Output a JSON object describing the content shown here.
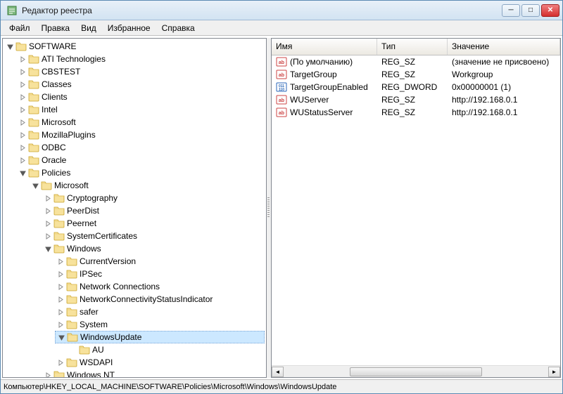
{
  "window": {
    "title": "Редактор реестра"
  },
  "menu": {
    "file": "Файл",
    "edit": "Правка",
    "view": "Вид",
    "favorites": "Избранное",
    "help": "Справка"
  },
  "tree": {
    "root": "SOFTWARE",
    "items": {
      "ati": "ATI Technologies",
      "cbs": "CBSTEST",
      "classes": "Classes",
      "clients": "Clients",
      "intel": "Intel",
      "microsoft": "Microsoft",
      "mozilla": "MozillaPlugins",
      "odbc": "ODBC",
      "oracle": "Oracle",
      "policies": "Policies",
      "pol_ms": "Microsoft",
      "crypto": "Cryptography",
      "peerdist": "PeerDist",
      "peernet": "Peernet",
      "syscert": "SystemCertificates",
      "windows": "Windows",
      "curver": "CurrentVersion",
      "ipsec": "IPSec",
      "netconn": "Network Connections",
      "netconnstatus": "NetworkConnectivityStatusIndicator",
      "safer": "safer",
      "system": "System",
      "windowsupdate": "WindowsUpdate",
      "au": "AU",
      "wsdapi": "WSDAPI",
      "winnt": "Windows NT"
    }
  },
  "list": {
    "headers": {
      "name": "Имя",
      "type": "Тип",
      "value": "Значение"
    },
    "rows": [
      {
        "icon": "sz",
        "name": "(По умолчанию)",
        "type": "REG_SZ",
        "value": "(значение не присвоено)"
      },
      {
        "icon": "sz",
        "name": "TargetGroup",
        "type": "REG_SZ",
        "value": "Workgroup"
      },
      {
        "icon": "dw",
        "name": "TargetGroupEnabled",
        "type": "REG_DWORD",
        "value": "0x00000001 (1)"
      },
      {
        "icon": "sz",
        "name": "WUServer",
        "type": "REG_SZ",
        "value": "http://192.168.0.1"
      },
      {
        "icon": "sz",
        "name": "WUStatusServer",
        "type": "REG_SZ",
        "value": "http://192.168.0.1"
      }
    ]
  },
  "status": {
    "path": "Компьютер\\HKEY_LOCAL_MACHINE\\SOFTWARE\\Policies\\Microsoft\\Windows\\WindowsUpdate"
  }
}
